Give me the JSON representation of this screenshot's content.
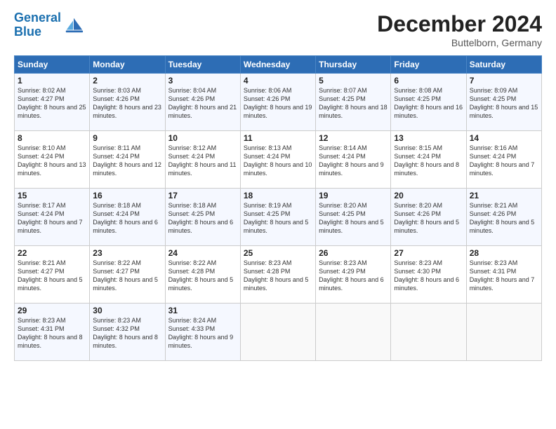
{
  "header": {
    "logo_line1": "General",
    "logo_line2": "Blue",
    "month": "December 2024",
    "location": "Buttelborn, Germany"
  },
  "days_of_week": [
    "Sunday",
    "Monday",
    "Tuesday",
    "Wednesday",
    "Thursday",
    "Friday",
    "Saturday"
  ],
  "weeks": [
    [
      {
        "day": "1",
        "sunrise": "8:02 AM",
        "sunset": "4:27 PM",
        "daylight": "8 hours and 25 minutes."
      },
      {
        "day": "2",
        "sunrise": "8:03 AM",
        "sunset": "4:26 PM",
        "daylight": "8 hours and 23 minutes."
      },
      {
        "day": "3",
        "sunrise": "8:04 AM",
        "sunset": "4:26 PM",
        "daylight": "8 hours and 21 minutes."
      },
      {
        "day": "4",
        "sunrise": "8:06 AM",
        "sunset": "4:26 PM",
        "daylight": "8 hours and 19 minutes."
      },
      {
        "day": "5",
        "sunrise": "8:07 AM",
        "sunset": "4:25 PM",
        "daylight": "8 hours and 18 minutes."
      },
      {
        "day": "6",
        "sunrise": "8:08 AM",
        "sunset": "4:25 PM",
        "daylight": "8 hours and 16 minutes."
      },
      {
        "day": "7",
        "sunrise": "8:09 AM",
        "sunset": "4:25 PM",
        "daylight": "8 hours and 15 minutes."
      }
    ],
    [
      {
        "day": "8",
        "sunrise": "8:10 AM",
        "sunset": "4:24 PM",
        "daylight": "8 hours and 13 minutes."
      },
      {
        "day": "9",
        "sunrise": "8:11 AM",
        "sunset": "4:24 PM",
        "daylight": "8 hours and 12 minutes."
      },
      {
        "day": "10",
        "sunrise": "8:12 AM",
        "sunset": "4:24 PM",
        "daylight": "8 hours and 11 minutes."
      },
      {
        "day": "11",
        "sunrise": "8:13 AM",
        "sunset": "4:24 PM",
        "daylight": "8 hours and 10 minutes."
      },
      {
        "day": "12",
        "sunrise": "8:14 AM",
        "sunset": "4:24 PM",
        "daylight": "8 hours and 9 minutes."
      },
      {
        "day": "13",
        "sunrise": "8:15 AM",
        "sunset": "4:24 PM",
        "daylight": "8 hours and 8 minutes."
      },
      {
        "day": "14",
        "sunrise": "8:16 AM",
        "sunset": "4:24 PM",
        "daylight": "8 hours and 7 minutes."
      }
    ],
    [
      {
        "day": "15",
        "sunrise": "8:17 AM",
        "sunset": "4:24 PM",
        "daylight": "8 hours and 7 minutes."
      },
      {
        "day": "16",
        "sunrise": "8:18 AM",
        "sunset": "4:24 PM",
        "daylight": "8 hours and 6 minutes."
      },
      {
        "day": "17",
        "sunrise": "8:18 AM",
        "sunset": "4:25 PM",
        "daylight": "8 hours and 6 minutes."
      },
      {
        "day": "18",
        "sunrise": "8:19 AM",
        "sunset": "4:25 PM",
        "daylight": "8 hours and 5 minutes."
      },
      {
        "day": "19",
        "sunrise": "8:20 AM",
        "sunset": "4:25 PM",
        "daylight": "8 hours and 5 minutes."
      },
      {
        "day": "20",
        "sunrise": "8:20 AM",
        "sunset": "4:26 PM",
        "daylight": "8 hours and 5 minutes."
      },
      {
        "day": "21",
        "sunrise": "8:21 AM",
        "sunset": "4:26 PM",
        "daylight": "8 hours and 5 minutes."
      }
    ],
    [
      {
        "day": "22",
        "sunrise": "8:21 AM",
        "sunset": "4:27 PM",
        "daylight": "8 hours and 5 minutes."
      },
      {
        "day": "23",
        "sunrise": "8:22 AM",
        "sunset": "4:27 PM",
        "daylight": "8 hours and 5 minutes."
      },
      {
        "day": "24",
        "sunrise": "8:22 AM",
        "sunset": "4:28 PM",
        "daylight": "8 hours and 5 minutes."
      },
      {
        "day": "25",
        "sunrise": "8:23 AM",
        "sunset": "4:28 PM",
        "daylight": "8 hours and 5 minutes."
      },
      {
        "day": "26",
        "sunrise": "8:23 AM",
        "sunset": "4:29 PM",
        "daylight": "8 hours and 6 minutes."
      },
      {
        "day": "27",
        "sunrise": "8:23 AM",
        "sunset": "4:30 PM",
        "daylight": "8 hours and 6 minutes."
      },
      {
        "day": "28",
        "sunrise": "8:23 AM",
        "sunset": "4:31 PM",
        "daylight": "8 hours and 7 minutes."
      }
    ],
    [
      {
        "day": "29",
        "sunrise": "8:23 AM",
        "sunset": "4:31 PM",
        "daylight": "8 hours and 8 minutes."
      },
      {
        "day": "30",
        "sunrise": "8:23 AM",
        "sunset": "4:32 PM",
        "daylight": "8 hours and 8 minutes."
      },
      {
        "day": "31",
        "sunrise": "8:24 AM",
        "sunset": "4:33 PM",
        "daylight": "8 hours and 9 minutes."
      },
      null,
      null,
      null,
      null
    ]
  ]
}
